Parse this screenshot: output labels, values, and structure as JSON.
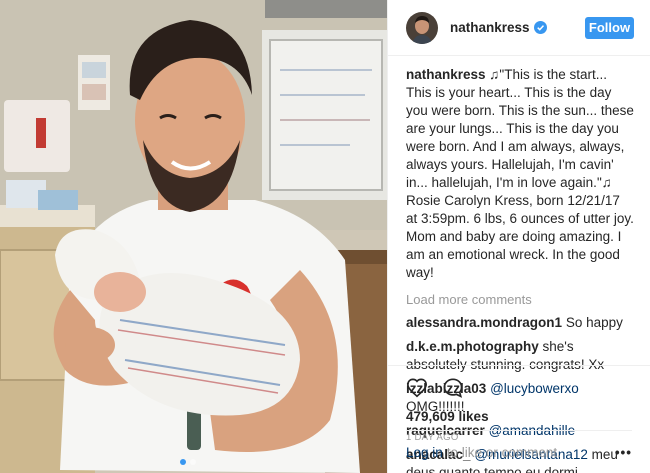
{
  "photo": {
    "alt_icon": "photo-dad-holding-newborn",
    "carousel_dots": 2,
    "active_dot": 0
  },
  "header": {
    "username": "nathankress",
    "verified_icon": "verified-badge-icon",
    "follow_label": "Follow"
  },
  "caption": {
    "username": "nathankress",
    "text": " ♫\"This is the start... This is your heart... This is the day you were born. This is the sun... these are your lungs... This is the day you were born. And I am always, always, always yours. Hallelujah, I'm cavin' in... hallelujah, I'm in love again.\"♫ Rosie Carolyn Kress, born 12/21/17 at 3:59pm. 6 lbs, 6 ounces of utter joy. Mom and baby are doing amazing. I am an emotional wreck. In the good way!"
  },
  "load_more": "Load more comments",
  "comments": [
    {
      "user": "alessandra.mondragon1",
      "mention": "",
      "text": " So happy"
    },
    {
      "user": "d.k.e.m.photography",
      "mention": "",
      "text": " she's absolutely stunning. congrats! Xx"
    },
    {
      "user": "izzlabizzla03",
      "mention": "@lucybowerxo",
      "text": " OMG!!!!!!!"
    },
    {
      "user": "raquelcarrer",
      "mention": "@amandahille",
      "text": ""
    },
    {
      "user": "anacalac_",
      "mention": "@murielsantana12",
      "text": " meu deus quanto tempo eu dormi"
    }
  ],
  "actions": {
    "like_icon": "heart-icon",
    "comment_icon": "comment-bubble-icon",
    "likes": "479,609 likes",
    "time": "1 DAY AGO"
  },
  "footer": {
    "login": "Log in",
    "rest": "to like or comment.",
    "more": "•••"
  },
  "colors": {
    "accent": "#3897f0",
    "link": "#003569",
    "muted": "#999999",
    "text": "#262626"
  }
}
